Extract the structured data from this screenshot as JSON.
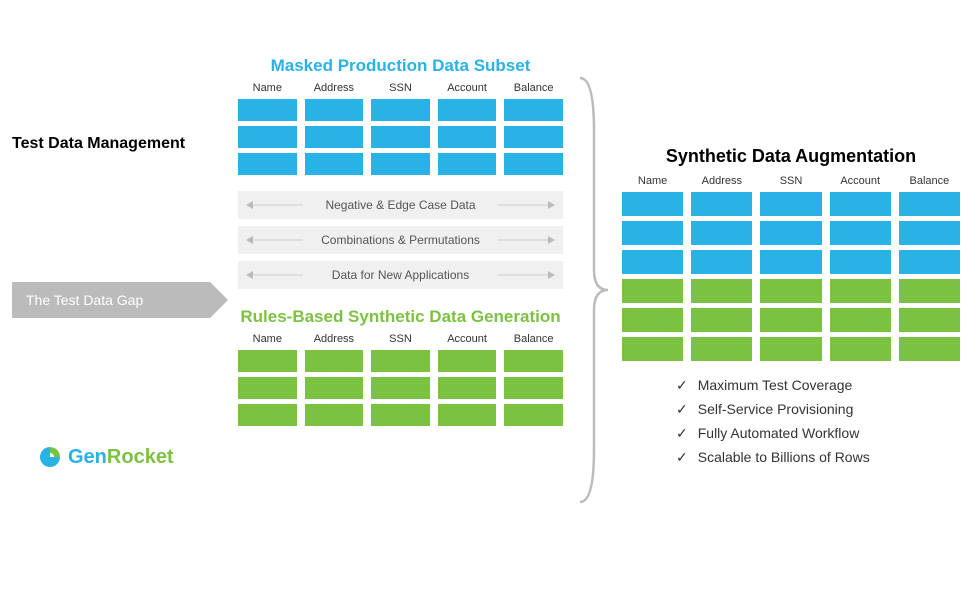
{
  "left": {
    "tdm_label": "Test Data Management",
    "gap_label": "The Test Data Gap",
    "logo_gen": "Gen",
    "logo_rocket": "Rocket"
  },
  "columns": [
    "Name",
    "Address",
    "SSN",
    "Account",
    "Balance"
  ],
  "center": {
    "top_title": "Masked Production Data Subset",
    "gap_items": [
      "Negative & Edge Case Data",
      "Combinations & Permutations",
      "Data for New Applications"
    ],
    "bottom_title": "Rules-Based Synthetic Data Generation"
  },
  "right": {
    "title": "Synthetic Data Augmentation",
    "benefits": [
      "Maximum Test Coverage",
      "Self-Service Provisioning",
      "Fully Automated Workflow",
      "Scalable to Billions of Rows"
    ]
  },
  "chart_data": {
    "type": "table",
    "description": "Conceptual diagram showing test data management gap filled by synthetic data augmentation",
    "tables": [
      {
        "name": "Masked Production Data Subset",
        "columns": [
          "Name",
          "Address",
          "SSN",
          "Account",
          "Balance"
        ],
        "rows": 3,
        "color": "blue"
      },
      {
        "name": "Rules-Based Synthetic Data Generation",
        "columns": [
          "Name",
          "Address",
          "SSN",
          "Account",
          "Balance"
        ],
        "rows": 3,
        "color": "green"
      },
      {
        "name": "Synthetic Data Augmentation",
        "columns": [
          "Name",
          "Address",
          "SSN",
          "Account",
          "Balance"
        ],
        "rows": 6,
        "row_colors": [
          "blue",
          "blue",
          "blue",
          "green",
          "green",
          "green"
        ]
      }
    ],
    "gap_categories": [
      "Negative & Edge Case Data",
      "Combinations & Permutations",
      "Data for New Applications"
    ],
    "benefits": [
      "Maximum Test Coverage",
      "Self-Service Provisioning",
      "Fully Automated Workflow",
      "Scalable to Billions of Rows"
    ],
    "colors": {
      "blue": "#29b2e6",
      "green": "#7cc242",
      "gray": "#bbb"
    }
  }
}
